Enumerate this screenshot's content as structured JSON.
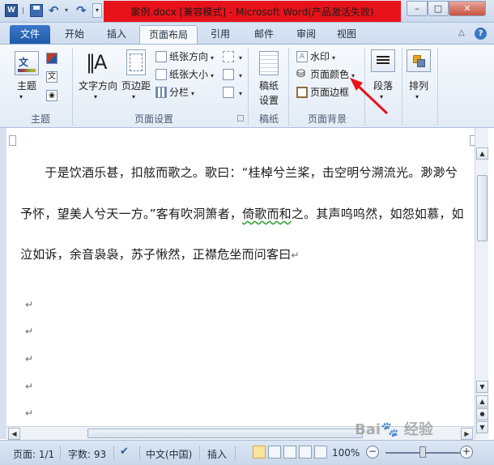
{
  "window": {
    "title": "案例.docx [兼容模式] - Microsoft Word(产品激活失败)",
    "logo_letter": "W",
    "title_highlight_color": "#e8121a",
    "buttons": {
      "minimize": "–",
      "maximize": "□",
      "close": "✕"
    }
  },
  "tabs": {
    "file": "文件",
    "items": [
      "开始",
      "插入",
      "页面布局",
      "引用",
      "邮件",
      "审阅",
      "视图"
    ],
    "active": "页面布局"
  },
  "ribbon": {
    "theme": {
      "big_label": "主题",
      "group_label": "主题"
    },
    "page_setup": {
      "text_direction": "文字方向",
      "margins": "页边距",
      "orientation": "纸张方向",
      "size": "纸张大小",
      "columns": "分栏",
      "group_label": "页面设置"
    },
    "paper": {
      "big_label_line1": "稿纸",
      "big_label_line2": "设置",
      "group_label": "稿纸"
    },
    "page_background": {
      "watermark": "水印",
      "page_color": "页面颜色",
      "page_border": "页面边框",
      "group_label": "页面背景"
    },
    "paragraph": {
      "big_label": "段落"
    },
    "arrange": {
      "big_label": "排列"
    }
  },
  "document": {
    "line1": "　　于是饮酒乐甚，扣舷而歌之。歌曰：“桂棹兮兰桨，击空明兮溯流光。渺渺兮",
    "line2_a": "予怀，望美人兮天一方。”客有吹洞箫者，",
    "line2_wavy": "倚歌而和",
    "line2_b": "之。其声呜呜然，如怨如慕，如",
    "line3": "泣如诉，余音袅袅，苏子愀然，正襟危坐而问客曰",
    "paragraph_mark": "↵"
  },
  "statusbar": {
    "page": "页面: 1/1",
    "words": "字数: 93",
    "language": "中文(中国)",
    "insert_mode": "插入",
    "zoom": "100%",
    "zoom_level_percent": 100
  },
  "annotation_color": "#e8121a"
}
